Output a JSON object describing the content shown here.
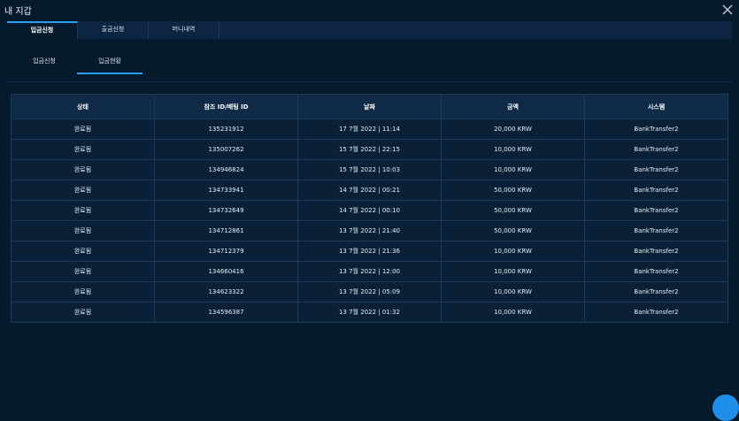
{
  "window": {
    "title": "내 지갑"
  },
  "tabs": [
    {
      "label": "입금신청"
    },
    {
      "label": "출금신청"
    },
    {
      "label": "머니내역"
    }
  ],
  "subtabs": [
    {
      "label": "입금신청"
    },
    {
      "label": "입금현황"
    }
  ],
  "table": {
    "headers": [
      "상태",
      "참조 ID/배팅 ID",
      "날짜",
      "금액",
      "시스템"
    ],
    "rows": [
      [
        "완료됨",
        "135231912",
        "17 7월 2022 | 11:14",
        "20,000 KRW",
        "BankTransfer2"
      ],
      [
        "완료됨",
        "135007262",
        "15 7월 2022 | 22:15",
        "10,000 KRW",
        "BankTransfer2"
      ],
      [
        "완료됨",
        "134946824",
        "15 7월 2022 | 10:03",
        "10,000 KRW",
        "BankTransfer2"
      ],
      [
        "완료됨",
        "134733941",
        "14 7월 2022 | 00:21",
        "50,000 KRW",
        "BankTransfer2"
      ],
      [
        "완료됨",
        "134732649",
        "14 7월 2022 | 00:10",
        "50,000 KRW",
        "BankTransfer2"
      ],
      [
        "완료됨",
        "134712861",
        "13 7월 2022 | 21:40",
        "50,000 KRW",
        "BankTransfer2"
      ],
      [
        "완료됨",
        "134712379",
        "13 7월 2022 | 21:36",
        "10,000 KRW",
        "BankTransfer2"
      ],
      [
        "완료됨",
        "134660416",
        "13 7월 2022 | 12:00",
        "10,000 KRW",
        "BankTransfer2"
      ],
      [
        "완료됨",
        "134623322",
        "13 7월 2022 | 05:09",
        "10,000 KRW",
        "BankTransfer2"
      ],
      [
        "완료됨",
        "134596387",
        "13 7월 2022 | 01:32",
        "10,000 KRW",
        "BankTransfer2"
      ]
    ]
  },
  "icons": {
    "close": "close-icon",
    "fab": "chat-button"
  },
  "colors": {
    "background": "#061a2e",
    "accent": "#2a9df4",
    "tab_bar": "#0c2540",
    "table_header": "#0f2b48"
  }
}
